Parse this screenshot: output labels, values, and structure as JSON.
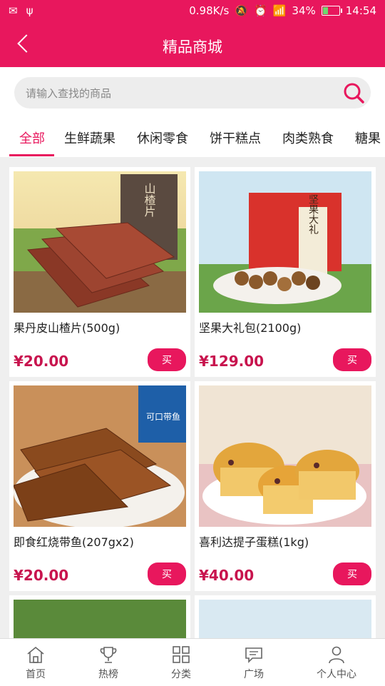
{
  "status": {
    "speed": "0.98K/s",
    "battery": "34%",
    "battery_level": 0.34,
    "time": "14:54"
  },
  "header": {
    "title": "精品商城"
  },
  "search": {
    "placeholder": "请输入查找的商品"
  },
  "tabs": [
    "全部",
    "生鲜蔬果",
    "休闲零食",
    "饼干糕点",
    "肉类熟食",
    "糖果"
  ],
  "products": [
    {
      "name": "果丹皮山楂片(500g)",
      "price": "¥20.00",
      "buy": "买",
      "pack_label": "山楂片"
    },
    {
      "name": "坚果大礼包(2100g)",
      "price": "¥129.00",
      "buy": "买",
      "pack_label": "坚果大礼"
    },
    {
      "name": "即食红烧带鱼(207gx2)",
      "price": "¥20.00",
      "buy": "买",
      "pack_label": "可口带鱼"
    },
    {
      "name": "喜利达提子蛋糕(1kg)",
      "price": "¥40.00",
      "buy": "买",
      "pack_label": ""
    }
  ],
  "nav": {
    "home": "首页",
    "hot": "热榜",
    "category": "分类",
    "square": "广场",
    "profile": "个人中心"
  },
  "colors": {
    "accent": "#e8175d",
    "price": "#c8144e"
  }
}
